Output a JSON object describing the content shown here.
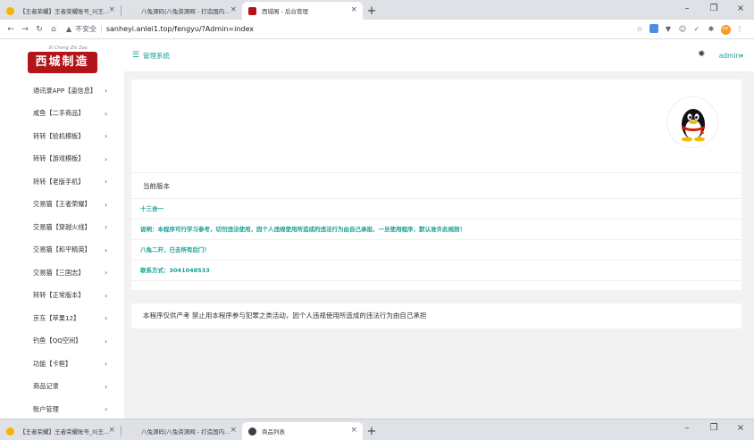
{
  "browser": {
    "tabs": [
      {
        "title": "【王者荣耀】王者荣耀账号_0|王..."
      },
      {
        "title": "八兔源码|八兔资源网 - 打造国内..."
      },
      {
        "title": "西城阁 - 后台管理"
      }
    ],
    "bottom_tabs": [
      {
        "title": "【王者荣耀】王者荣耀账号_0|王..."
      },
      {
        "title": "八兔源码|八兔资源网 - 打造国内..."
      },
      {
        "title": "商品列表"
      }
    ],
    "address": {
      "insecure_label": "不安全",
      "url": "sanheyi.anlei1.top/fengyu/?Admin=index"
    },
    "avatar_text": "FP"
  },
  "app": {
    "logo_text": "西城制造",
    "logo_script": "Xi Cheng Zhi Zao",
    "system_title": "管理系统",
    "admin_label": "admin",
    "menu": [
      "通讯录APP【盗信息】",
      "咸鱼【二手商品】",
      "转转【验机模板】",
      "转转【游戏模板】",
      "转转【老版手机】",
      "交易猫【王者荣耀】",
      "交易猫【穿越火线】",
      "交易猫【和平精英】",
      "交易猫【三国志】",
      "转转【正常版本】",
      "京东【苹果12】",
      "钓鱼【QQ空间】",
      "功能【卡框】",
      "商品记录",
      "账户管理"
    ],
    "version_header": "当前版本",
    "info_rows": [
      "十三合一",
      "说明：本程序可行学习参考，切勿违法使用，因个人违规使用所造成的违法行为由自己承担，一旦使用程序，默认准许此规则！",
      "八兔二开，已去所有后门！",
      "联系方式：3041048533"
    ],
    "disclaimer": "本程序仅供产考 禁止用本程序参与犯罪之类活动，因个人违规使用所造成的违法行为由自己承担"
  }
}
